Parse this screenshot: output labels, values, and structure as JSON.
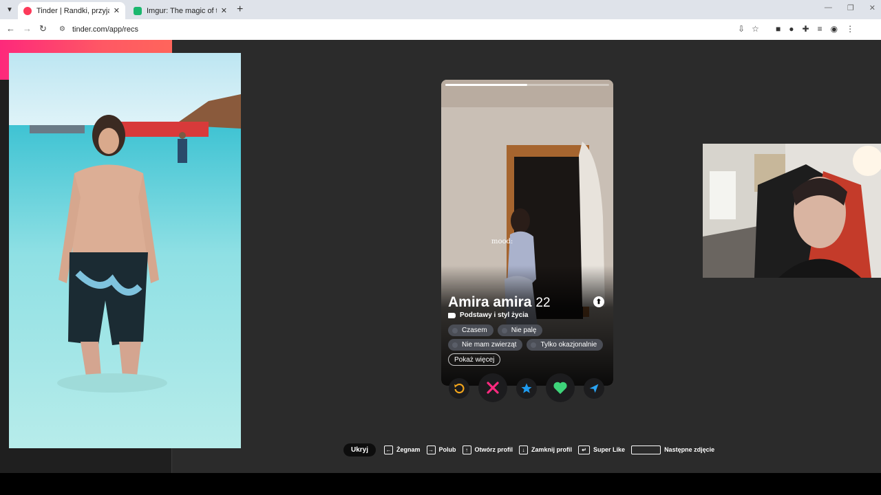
{
  "browser": {
    "tabs": [
      {
        "title": "Tinder | Randki, przyjaźń, nowe",
        "active": true,
        "favicon_color": "#fd3a5a"
      },
      {
        "title": "Imgur: The magic of the Interne",
        "active": false,
        "favicon_color": "#1bb76e"
      }
    ],
    "new_tab": "+",
    "url": "tinder.com/app/recs"
  },
  "card": {
    "photo_overlay_text": "mood:",
    "name": "Amira amira",
    "age": "22",
    "section_label": "Podstawy i styl życia",
    "chips_row1": [
      "Czasem",
      "Nie palę"
    ],
    "chips_row2": [
      "Nie mam zwierząt",
      "Tylko okazjonalnie"
    ],
    "show_more": "Pokaż więcej",
    "photo_progress": 0.5
  },
  "actions": {
    "rewind": "rewind-icon",
    "nope": "x-icon",
    "super_like": "star-icon",
    "like": "heart-icon",
    "boost": "send-icon",
    "colors": {
      "rewind": "#f3a51b",
      "nope": "#fd2a7f",
      "super_like": "#1e9bef",
      "like": "#3ed47a",
      "boost": "#2aa4f4"
    }
  },
  "shortcuts": {
    "hide": "Ukryj",
    "items": [
      {
        "key": "←",
        "label": "Żegnam"
      },
      {
        "key": "→",
        "label": "Polub"
      },
      {
        "key": "↑",
        "label": "Otwórz profil"
      },
      {
        "key": "↓",
        "label": "Zamknij profil"
      },
      {
        "key": "↵",
        "label": "Super Like"
      },
      {
        "key": "",
        "label": "Następne zdjęcie"
      }
    ]
  },
  "theme": {
    "brand_gradient_start": "#fd297b",
    "brand_gradient_end": "#ff655b",
    "page_bg": "#2b2b2b"
  }
}
